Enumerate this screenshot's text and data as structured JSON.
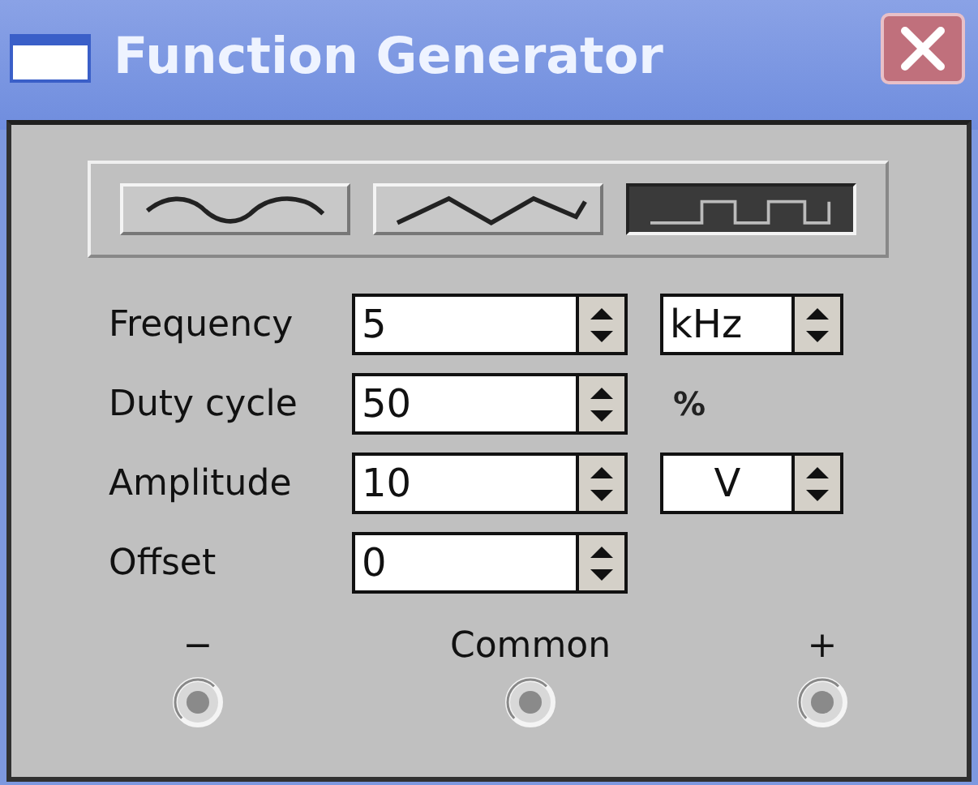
{
  "window": {
    "title": "Function Generator"
  },
  "waveforms": [
    {
      "kind": "sine",
      "selected": false
    },
    {
      "kind": "triangle",
      "selected": false
    },
    {
      "kind": "square",
      "selected": true
    }
  ],
  "fields": [
    {
      "label": "Frequency",
      "value": "5",
      "unit": {
        "kind": "spinner",
        "value": "kHz"
      }
    },
    {
      "label": "Duty cycle",
      "value": "50",
      "unit": {
        "kind": "text",
        "value": "%"
      }
    },
    {
      "label": "Amplitude",
      "value": "10",
      "unit": {
        "kind": "spinner",
        "value": "V"
      }
    },
    {
      "label": "Offset",
      "value": "0"
    }
  ],
  "terminals": [
    {
      "label": "−"
    },
    {
      "label": "Common"
    },
    {
      "label": "+"
    }
  ]
}
